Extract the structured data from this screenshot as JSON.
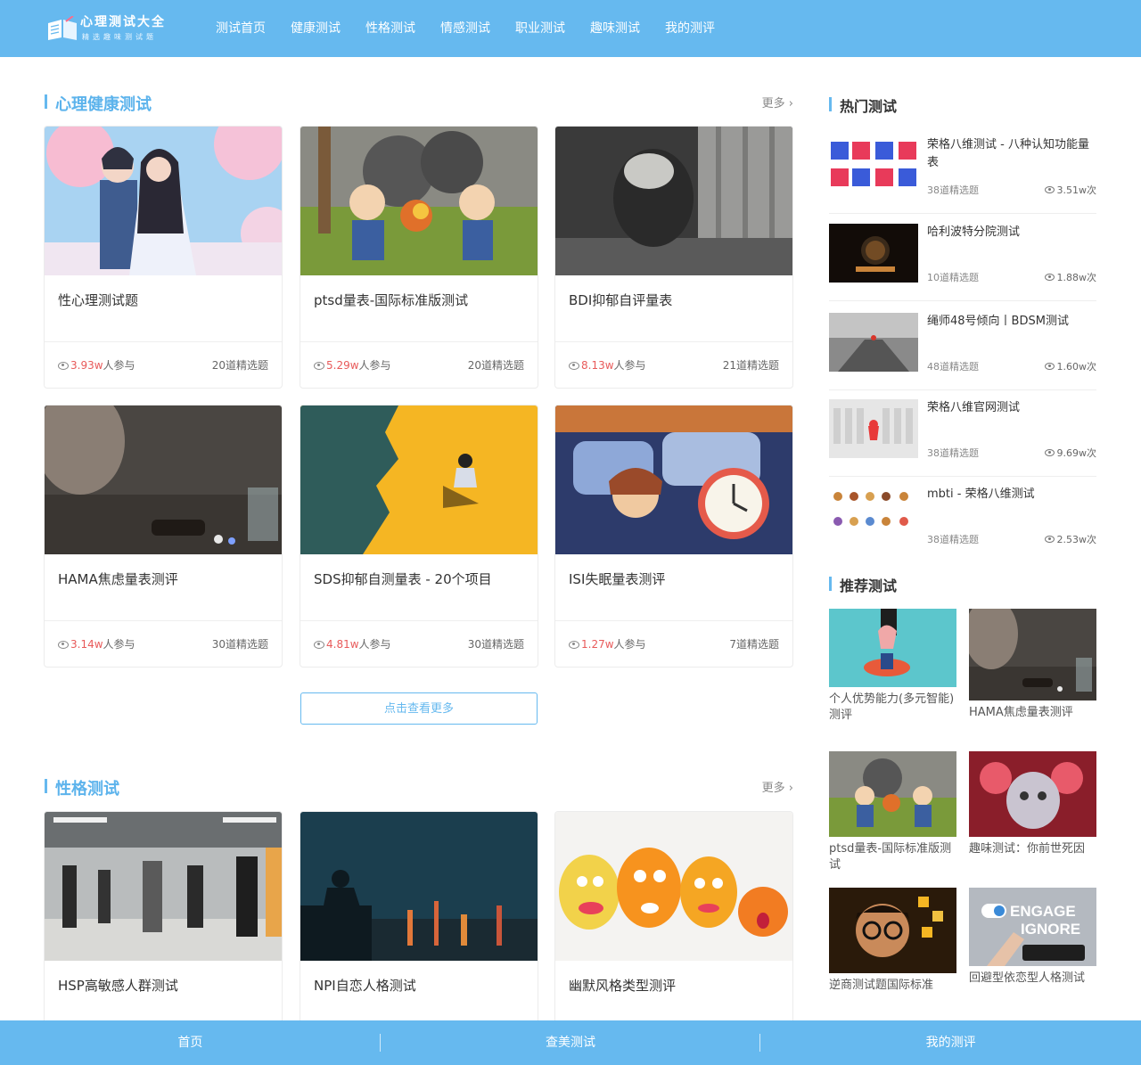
{
  "header": {
    "logo_title": "心理测试大全",
    "logo_sub": "精选趣味测试题",
    "nav": [
      "测试首页",
      "健康测试",
      "性格测试",
      "情感测试",
      "职业测试",
      "趣味测试",
      "我的测评"
    ]
  },
  "health_section": {
    "title": "心理健康测试",
    "more": "更多",
    "cards": [
      {
        "title": "性心理测试题",
        "count": "3.93w",
        "count_suffix": "人参与",
        "questions": "20道精选题"
      },
      {
        "title": "ptsd量表-国际标准版测试",
        "count": "5.29w",
        "count_suffix": "人参与",
        "questions": "20道精选题"
      },
      {
        "title": "BDI抑郁自评量表",
        "count": "8.13w",
        "count_suffix": "人参与",
        "questions": "21道精选题"
      },
      {
        "title": "HAMA焦虑量表测评",
        "count": "3.14w",
        "count_suffix": "人参与",
        "questions": "30道精选题"
      },
      {
        "title": "SDS抑郁自测量表 - 20个项目",
        "count": "4.81w",
        "count_suffix": "人参与",
        "questions": "30道精选题"
      },
      {
        "title": "ISI失眠量表测评",
        "count": "1.27w",
        "count_suffix": "人参与",
        "questions": "7道精选题"
      }
    ],
    "load_more": "点击查看更多"
  },
  "personality_section": {
    "title": "性格测试",
    "more": "更多",
    "cards": [
      {
        "title": "HSP高敏感人群测试"
      },
      {
        "title": "NPI自恋人格测试"
      },
      {
        "title": "幽默风格类型测评"
      }
    ]
  },
  "sidebar": {
    "hot_title": "热门测试",
    "hot": [
      {
        "title": "荣格八维测试 - 八种认知功能量表",
        "questions": "38道精选题",
        "views": "3.51w次"
      },
      {
        "title": "哈利波特分院测试",
        "questions": "10道精选题",
        "views": "1.88w次"
      },
      {
        "title": "绳师48号倾向丨BDSM测试",
        "questions": "48道精选题",
        "views": "1.60w次"
      },
      {
        "title": "荣格八维官网测试",
        "questions": "38道精选题",
        "views": "9.69w次"
      },
      {
        "title": "mbti - 荣格八维测试",
        "questions": "38道精选题",
        "views": "2.53w次"
      }
    ],
    "rec_title": "推荐测试",
    "rec": [
      {
        "title": "个人优势能力(多元智能)测评"
      },
      {
        "title": "HAMA焦虑量表测评"
      },
      {
        "title": "ptsd量表-国际标准版测试"
      },
      {
        "title": "趣味测试：你前世死因"
      },
      {
        "title": "逆商测试题国际标准"
      },
      {
        "title": "回避型依恋型人格测试"
      }
    ],
    "engage_text": "ENGAGE",
    "ignore_text": "IGNORE"
  },
  "bottombar": [
    "首页",
    "查美测试",
    "我的测评"
  ],
  "colors": {
    "brand": "#66b9ef",
    "accent_text": "#5cb3ec",
    "count": "#e85a5a"
  }
}
